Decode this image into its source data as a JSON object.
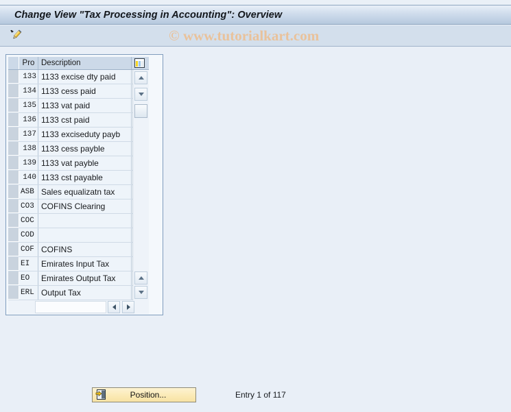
{
  "window": {
    "title": "Change View \"Tax Processing in Accounting\": Overview"
  },
  "toolbar": {
    "edit_icon": "pencil-edit-icon",
    "watermark": "© www.tutorialkart.com"
  },
  "table": {
    "columns": [
      {
        "key": "pro",
        "label": "Pro"
      },
      {
        "key": "description",
        "label": "Description"
      }
    ],
    "config_icon": "table-settings-icon",
    "rows": [
      {
        "pro": "133",
        "description": "1133 excise dty paid"
      },
      {
        "pro": "134",
        "description": "1133 cess paid"
      },
      {
        "pro": "135",
        "description": "1133 vat paid"
      },
      {
        "pro": "136",
        "description": "1133 cst paid"
      },
      {
        "pro": "137",
        "description": "1133 exciseduty payb"
      },
      {
        "pro": "138",
        "description": "1133 cess payble"
      },
      {
        "pro": "139",
        "description": "1133 vat payble"
      },
      {
        "pro": "140",
        "description": "1133 cst payable"
      },
      {
        "pro": "ASB",
        "description": "Sales equalizatn tax"
      },
      {
        "pro": "CO3",
        "description": "COFINS Clearing"
      },
      {
        "pro": "COC",
        "description": ""
      },
      {
        "pro": "COD",
        "description": ""
      },
      {
        "pro": "COF",
        "description": "COFINS"
      },
      {
        "pro": "EI",
        "description": "Emirates Input Tax"
      },
      {
        "pro": "EO",
        "description": "Emirates Output Tax"
      },
      {
        "pro": "ERL",
        "description": "Output Tax"
      }
    ],
    "scroll": {
      "up_icon": "scroll-up-arrow-icon",
      "down_icon": "scroll-down-arrow-icon",
      "left_icon": "scroll-left-arrow-icon",
      "right_icon": "scroll-right-arrow-icon"
    }
  },
  "footer": {
    "position_label": "Position...",
    "position_icon": "position-jump-icon",
    "entry_status": "Entry 1 of 117"
  },
  "colors": {
    "title_bar_top": "#e8eff8",
    "title_bar_bottom": "#b6c9de",
    "toolbar_bg": "#d3dfec",
    "page_bg": "#e9eff7",
    "table_header_bg": "#ccd9e8",
    "cell_bg": "#eef4fa",
    "row_selector_bg": "#c9d3de",
    "button_yellow": "#fbeab6",
    "watermark_color": "#edbd8e"
  }
}
